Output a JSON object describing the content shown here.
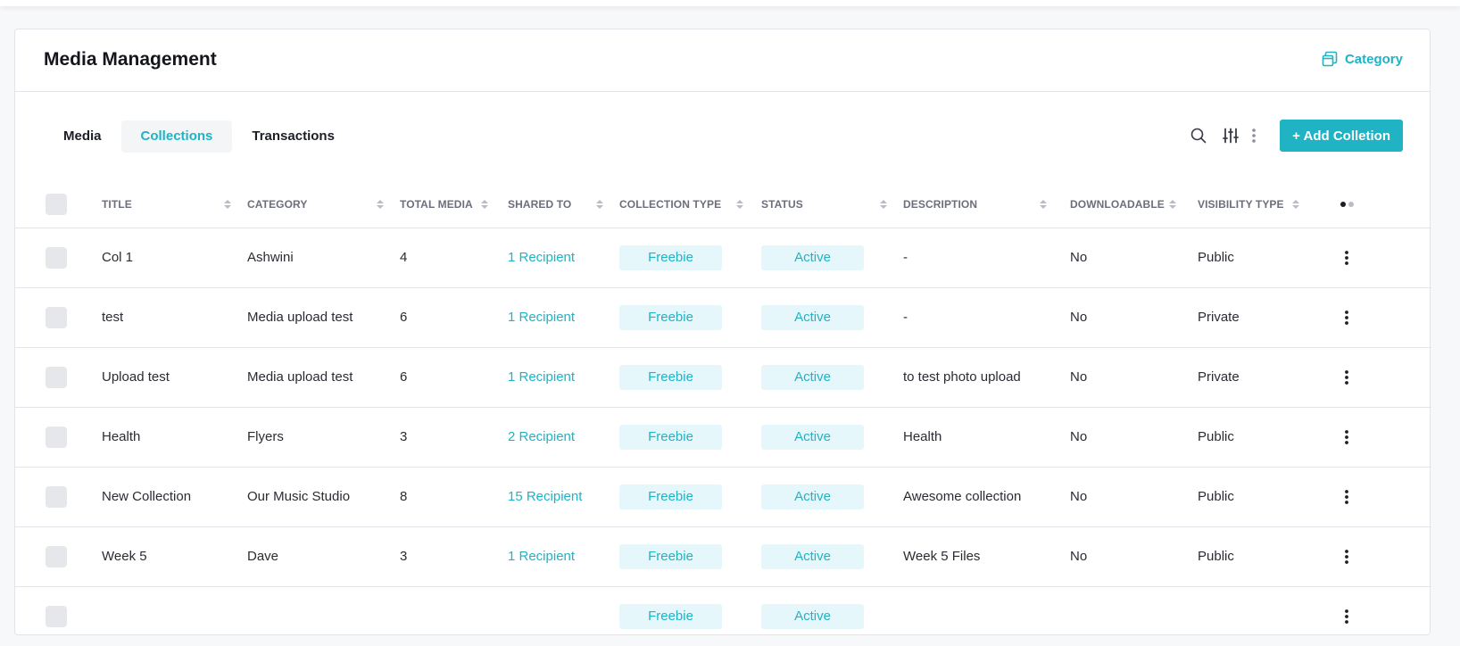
{
  "header": {
    "title": "Media Management",
    "category_label": "Category"
  },
  "tabs": [
    {
      "label": "Media",
      "active": false
    },
    {
      "label": "Collections",
      "active": true
    },
    {
      "label": "Transactions",
      "active": false
    }
  ],
  "toolbar": {
    "add_label": "+ Add Colletion"
  },
  "table": {
    "columns": [
      "TITLE",
      "CATEGORY",
      "TOTAL MEDIA",
      "SHARED TO",
      "COLLECTION TYPE",
      "STATUS",
      "DESCRIPTION",
      "DOWNLOADABLE",
      "VISIBILITY TYPE"
    ],
    "rows": [
      {
        "title": "Col 1",
        "category": "Ashwini",
        "total_media": "4",
        "shared_to": "1 Recipient",
        "collection_type": "Freebie",
        "status": "Active",
        "description": "-",
        "downloadable": "No",
        "visibility": "Public"
      },
      {
        "title": "test",
        "category": "Media upload test",
        "total_media": "6",
        "shared_to": "1 Recipient",
        "collection_type": "Freebie",
        "status": "Active",
        "description": "-",
        "downloadable": "No",
        "visibility": "Private"
      },
      {
        "title": "Upload test",
        "category": "Media upload test",
        "total_media": "6",
        "shared_to": "1 Recipient",
        "collection_type": "Freebie",
        "status": "Active",
        "description": "to test photo upload",
        "downloadable": "No",
        "visibility": "Private"
      },
      {
        "title": "Health",
        "category": "Flyers",
        "total_media": "3",
        "shared_to": "2 Recipient",
        "collection_type": "Freebie",
        "status": "Active",
        "description": "Health",
        "downloadable": "No",
        "visibility": "Public"
      },
      {
        "title": "New Collection",
        "category": "Our Music Studio",
        "total_media": "8",
        "shared_to": "15 Recipient",
        "collection_type": "Freebie",
        "status": "Active",
        "description": "Awesome collection",
        "downloadable": "No",
        "visibility": "Public"
      },
      {
        "title": "Week 5",
        "category": "Dave",
        "total_media": "3",
        "shared_to": "1 Recipient",
        "collection_type": "Freebie",
        "status": "Active",
        "description": "Week 5 Files",
        "downloadable": "No",
        "visibility": "Public"
      },
      {
        "title": "",
        "category": "",
        "total_media": "",
        "shared_to": "",
        "collection_type": "Freebie",
        "status": "Active",
        "description": "",
        "downloadable": "",
        "visibility": ""
      }
    ]
  },
  "icons": {
    "category": "folders-icon",
    "search": "search-icon",
    "filter": "sliders-icon",
    "more": "kebab-icon",
    "row_menu": "kebab-icon"
  },
  "colors": {
    "accent": "#1fb3c4",
    "pill_bg": "#e6f7fb",
    "title": "#14161c"
  }
}
